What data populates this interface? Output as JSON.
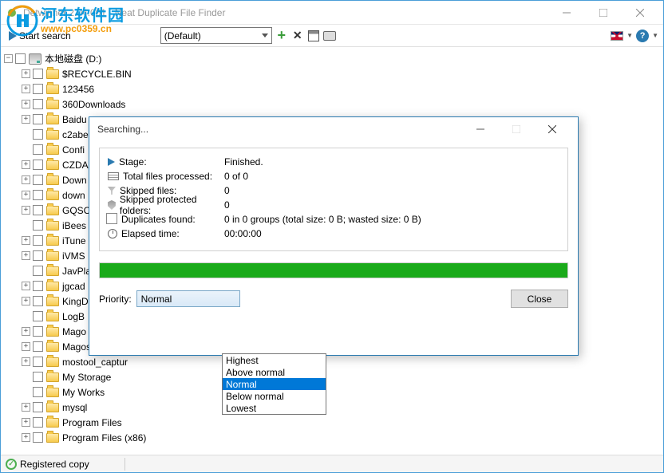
{
  "window": {
    "title": "Detwinner 2.04.001 - Neat Duplicate File Finder"
  },
  "toolbar": {
    "start_label": "Start search",
    "profile": "(Default)"
  },
  "watermark": {
    "cn": "河东软件园",
    "url": "www.pc0359.cn"
  },
  "tree": {
    "root": "本地磁盘 (D:)",
    "items": [
      {
        "label": "$RECYCLE.BIN",
        "exp": "+"
      },
      {
        "label": "123456",
        "exp": "+"
      },
      {
        "label": "360Downloads",
        "exp": "+"
      },
      {
        "label": "Baidu",
        "exp": "+"
      },
      {
        "label": "c2abe",
        "exp": ""
      },
      {
        "label": "Confi",
        "exp": ""
      },
      {
        "label": "CZDA",
        "exp": "+"
      },
      {
        "label": "Down",
        "exp": "+"
      },
      {
        "label": "down",
        "exp": "+"
      },
      {
        "label": "GQSC",
        "exp": "+"
      },
      {
        "label": "iBees",
        "exp": ""
      },
      {
        "label": "iTune",
        "exp": "+"
      },
      {
        "label": "iVMS",
        "exp": "+"
      },
      {
        "label": "JavPla",
        "exp": ""
      },
      {
        "label": "jgcad",
        "exp": "+"
      },
      {
        "label": "KingD",
        "exp": "+"
      },
      {
        "label": "LogB",
        "exp": ""
      },
      {
        "label": "Mago",
        "exp": "+"
      },
      {
        "label": "Magoshare Te",
        "exp": "+"
      },
      {
        "label": "mostool_captur",
        "exp": "+"
      },
      {
        "label": "My Storage",
        "exp": ""
      },
      {
        "label": "My Works",
        "exp": ""
      },
      {
        "label": "mysql",
        "exp": "+"
      },
      {
        "label": "Program Files",
        "exp": "+"
      },
      {
        "label": "Program Files (x86)",
        "exp": "+"
      }
    ]
  },
  "dialog": {
    "title": "Searching...",
    "rows": {
      "stage_lbl": "Stage:",
      "stage_val": "Finished.",
      "total_lbl": "Total files processed:",
      "total_val": "0 of 0",
      "skip_lbl": "Skipped files:",
      "skip_val": "0",
      "prot_lbl": "Skipped protected folders:",
      "prot_val": "0",
      "dup_lbl": "Duplicates found:",
      "dup_val": "0 in 0 groups (total size: 0 B; wasted size: 0 B)",
      "time_lbl": "Elapsed time:",
      "time_val": "00:00:00"
    },
    "priority_lbl": "Priority:",
    "priority_val": "Normal",
    "close": "Close"
  },
  "dropdown": {
    "o1": "Highest",
    "o2": "Above normal",
    "o3": "Normal",
    "o4": "Below normal",
    "o5": "Lowest"
  },
  "status": {
    "text": "Registered copy"
  }
}
